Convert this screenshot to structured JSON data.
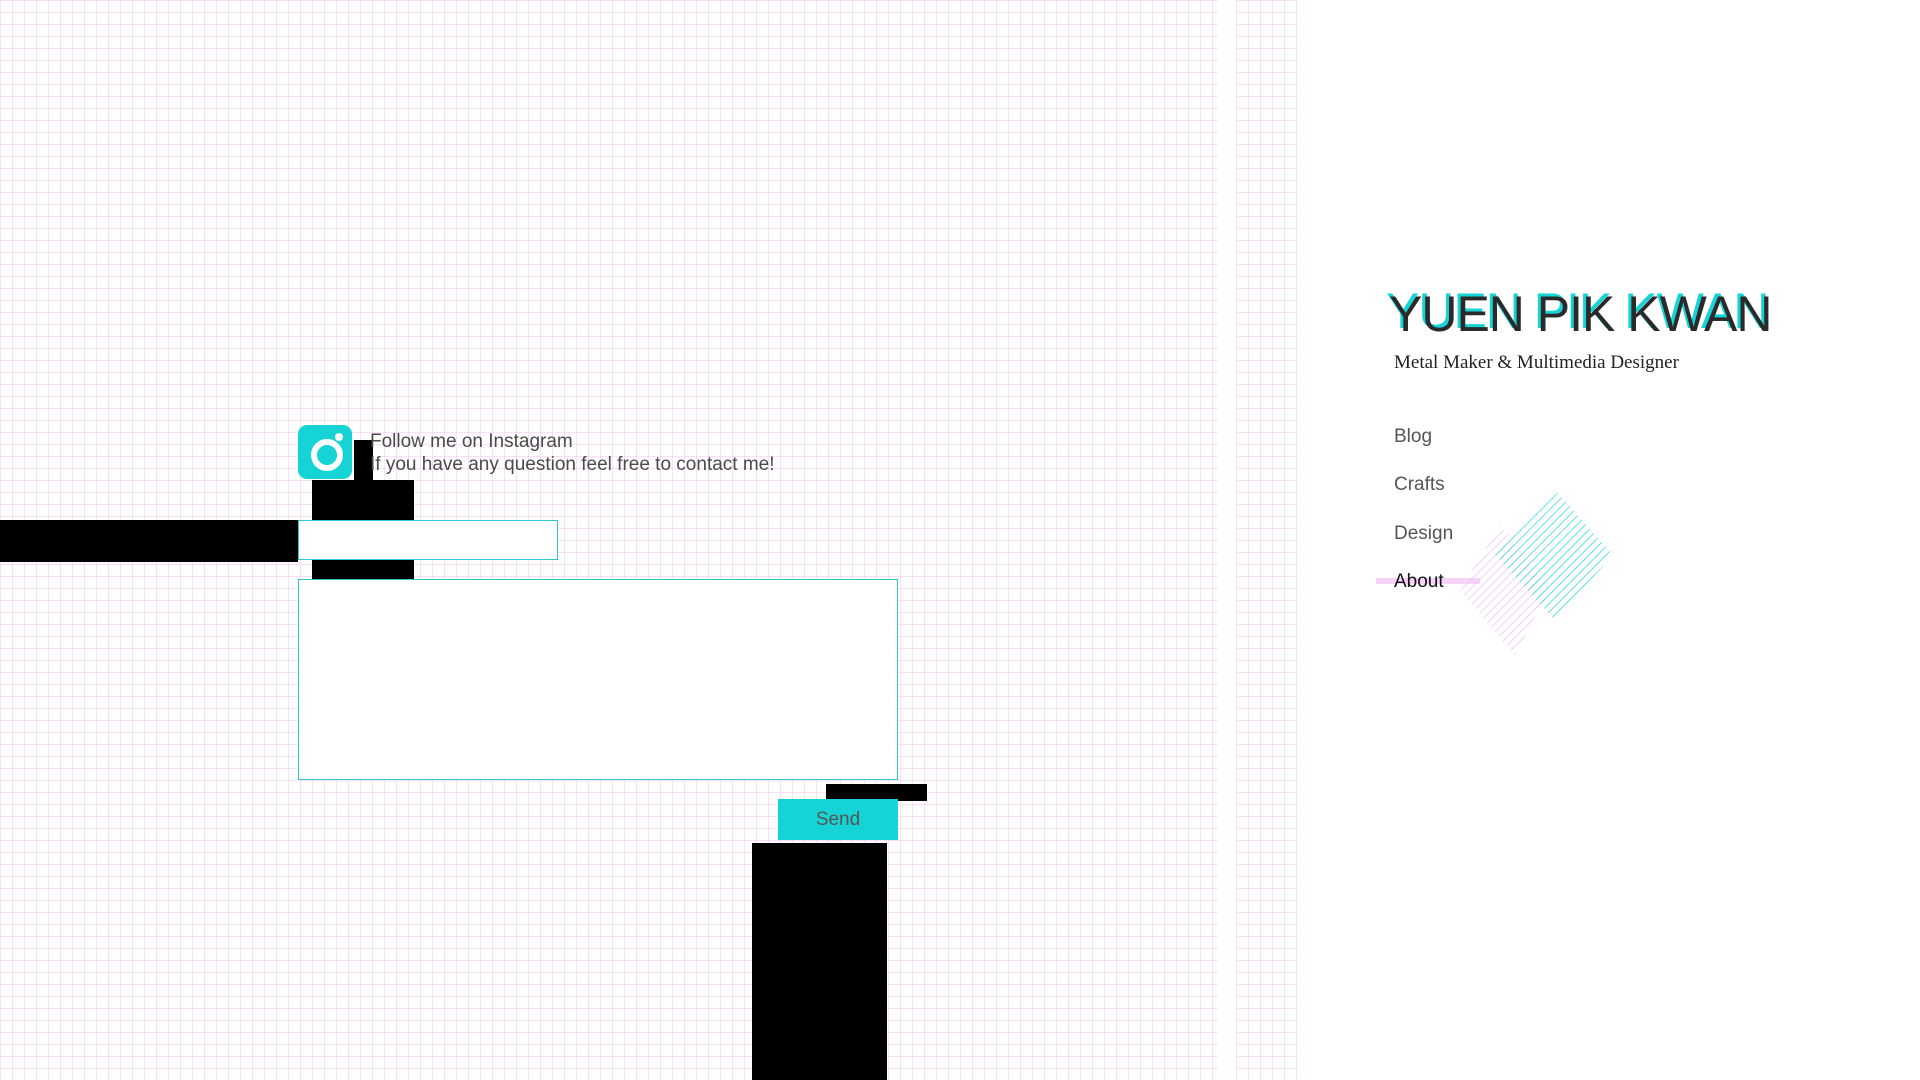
{
  "colors": {
    "accent": "#16d4d6",
    "grid": "#ecaaec",
    "text": "#4a4a4a"
  },
  "contact": {
    "instagram_icon": "instagram-icon",
    "follow_text": "Follow me on Instagram",
    "contact_text": "If you have any question feel free to contact me!",
    "name_value": "",
    "message_value": "",
    "send_label": "Send"
  },
  "sidebar": {
    "title": "YUEN PIK KWAN",
    "subtitle": "Metal Maker & Multimedia Designer",
    "nav": [
      {
        "label": "Blog",
        "active": false
      },
      {
        "label": "Crafts",
        "active": false
      },
      {
        "label": "Design",
        "active": false
      },
      {
        "label": "About",
        "active": true
      }
    ]
  }
}
